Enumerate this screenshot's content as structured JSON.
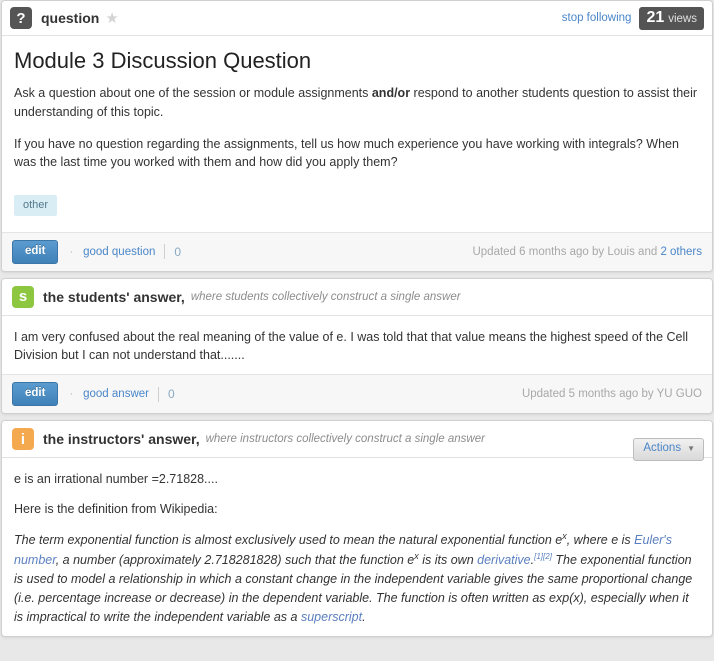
{
  "question": {
    "badge_icon": "question-mark-icon",
    "badge_label": "?",
    "header_title": "question",
    "star_icon": "★",
    "follow_link": "stop following",
    "views_count": "21",
    "views_label": "views",
    "heading": "Module 3 Discussion Question",
    "para1_a": "Ask a question about one of the session or module assignments ",
    "para1_b": "and/or",
    "para1_c": " respond to another students question to assist their understanding of this topic.",
    "para2": "If you have no question regarding the assignments, tell us how much experience you have working with integrals? When was the last time you worked with them and how did you apply them?",
    "tag": "other",
    "footer": {
      "edit_label": "edit",
      "separator": "·",
      "vote_label": "good question",
      "vote_count": "0",
      "updated_prefix": "Updated 6 months ago by Louis and ",
      "updated_link": "2 others"
    }
  },
  "students_answer": {
    "badge_icon": "students-icon",
    "badge_label": "s",
    "title": "the students' answer,",
    "subtitle": "where students collectively construct a single answer",
    "body": "I am very confused about the real meaning of the value of e. I was told that that value means the highest speed of the Cell Division but I can not understand that.......",
    "footer": {
      "edit_label": "edit",
      "separator": "·",
      "vote_label": "good answer",
      "vote_count": "0",
      "updated_text": "Updated 5 months ago by YU GUO"
    }
  },
  "instructors_answer": {
    "badge_icon": "instructors-icon",
    "badge_label": "i",
    "title": "the instructors' answer,",
    "subtitle": "where instructors collectively construct a single answer",
    "actions_label": "Actions",
    "caret_icon": "▼",
    "para1": "e is an irrational number =2.71828....",
    "para2": "Here is the definition from Wikipedia:",
    "wiki": {
      "s1": "The term exponential function is almost exclusively used to mean the natural exponential function e",
      "sup1": "x",
      "s2": ", where e is ",
      "link1": "Euler's number",
      "s3": ", a number (approximately 2.718281828) such that the function e",
      "sup2": "x",
      "s4": " is its own ",
      "link2": "derivative",
      "s5": ".",
      "ref1": "[1]",
      "ref2": "[2]",
      "s6": " The exponential function is used to model a relationship in which a constant change in the independent variable gives the same proportional change (i.e. percentage increase or decrease) in the dependent variable. The function is often written as exp(x), especially when it is impractical to write the independent variable as a ",
      "link3": "superscript",
      "s7": "."
    }
  },
  "colors": {
    "question_badge": "#555555",
    "students_badge": "#8dc63f",
    "instructors_badge": "#f5a94e",
    "link": "#4a86c8",
    "button_blue": "#4a8cc4",
    "tag_bg": "#d9edf5",
    "views_bg": "#545454"
  }
}
